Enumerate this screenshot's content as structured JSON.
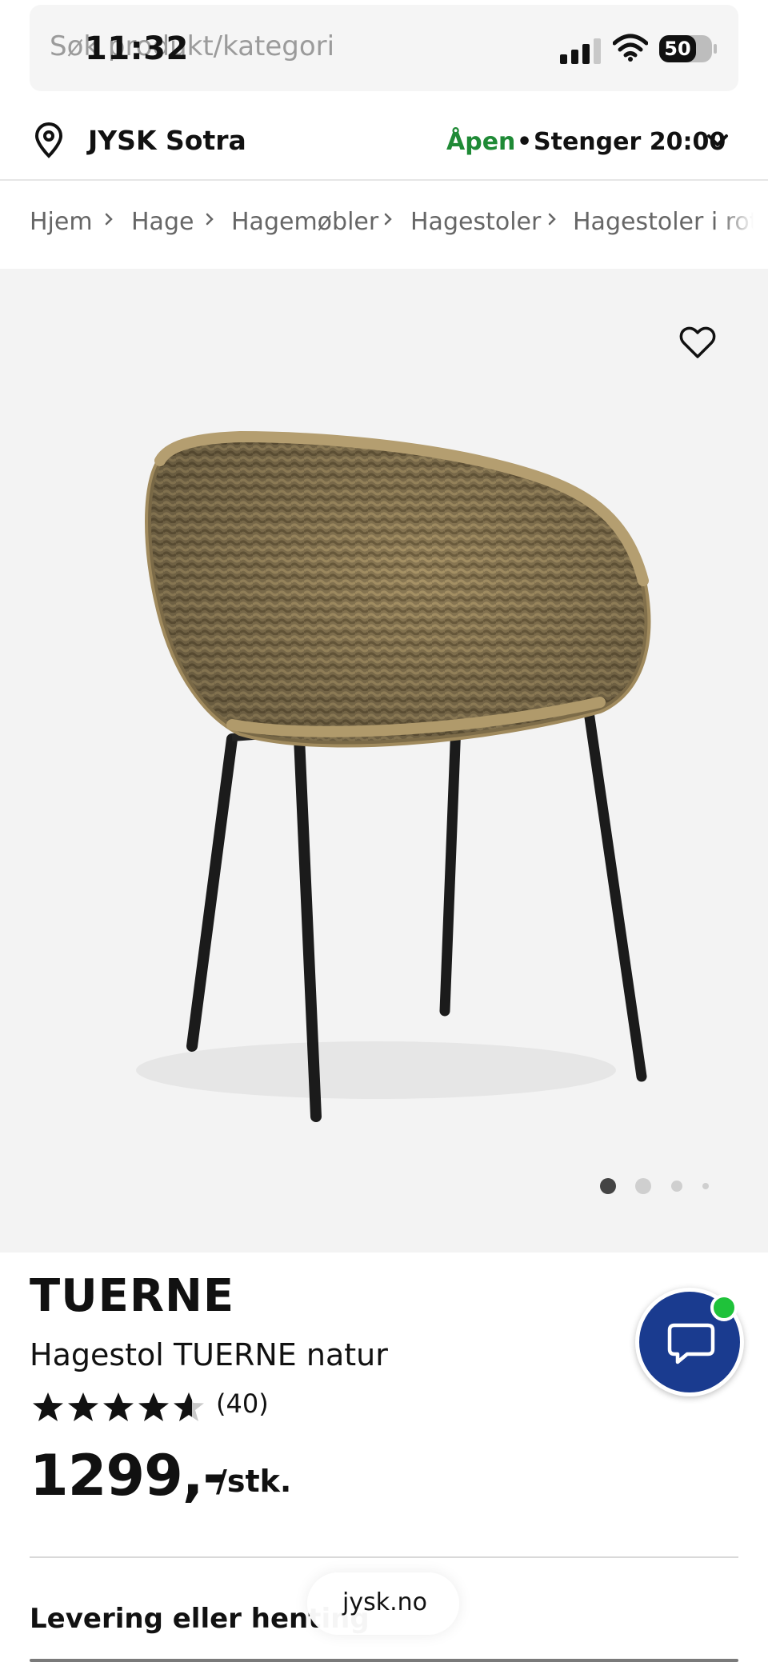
{
  "status_bar": {
    "time": "11:32",
    "battery": "50",
    "icons": [
      "signal-icon",
      "wifi-icon",
      "battery-icon"
    ]
  },
  "search": {
    "placeholder": "Søk produkt/kategori"
  },
  "store": {
    "name": "JYSK Sotra",
    "status": "Åpen",
    "separator": "•",
    "hours": "Stenger 20:00",
    "status_color": "#1f8a36"
  },
  "breadcrumb": {
    "items": [
      "Hjem",
      "Hage",
      "Hagemøbler",
      "Hagestoler",
      "Hagestoler i rotting"
    ]
  },
  "gallery": {
    "image_count": 4,
    "active_index": 0
  },
  "product": {
    "brand": "TUERNE",
    "title": "Hagestol TUERNE natur",
    "rating": 4.6,
    "rating_max": 5,
    "review_count": "(40)",
    "price": "1299,-",
    "unit": "/stk."
  },
  "delivery": {
    "heading": "Levering eller henting"
  },
  "browser": {
    "url": "jysk.no"
  },
  "colors": {
    "chat_fab": "#1a3b8f",
    "online_badge": "#1fc23a",
    "gallery_bg": "#f3f3f3"
  }
}
